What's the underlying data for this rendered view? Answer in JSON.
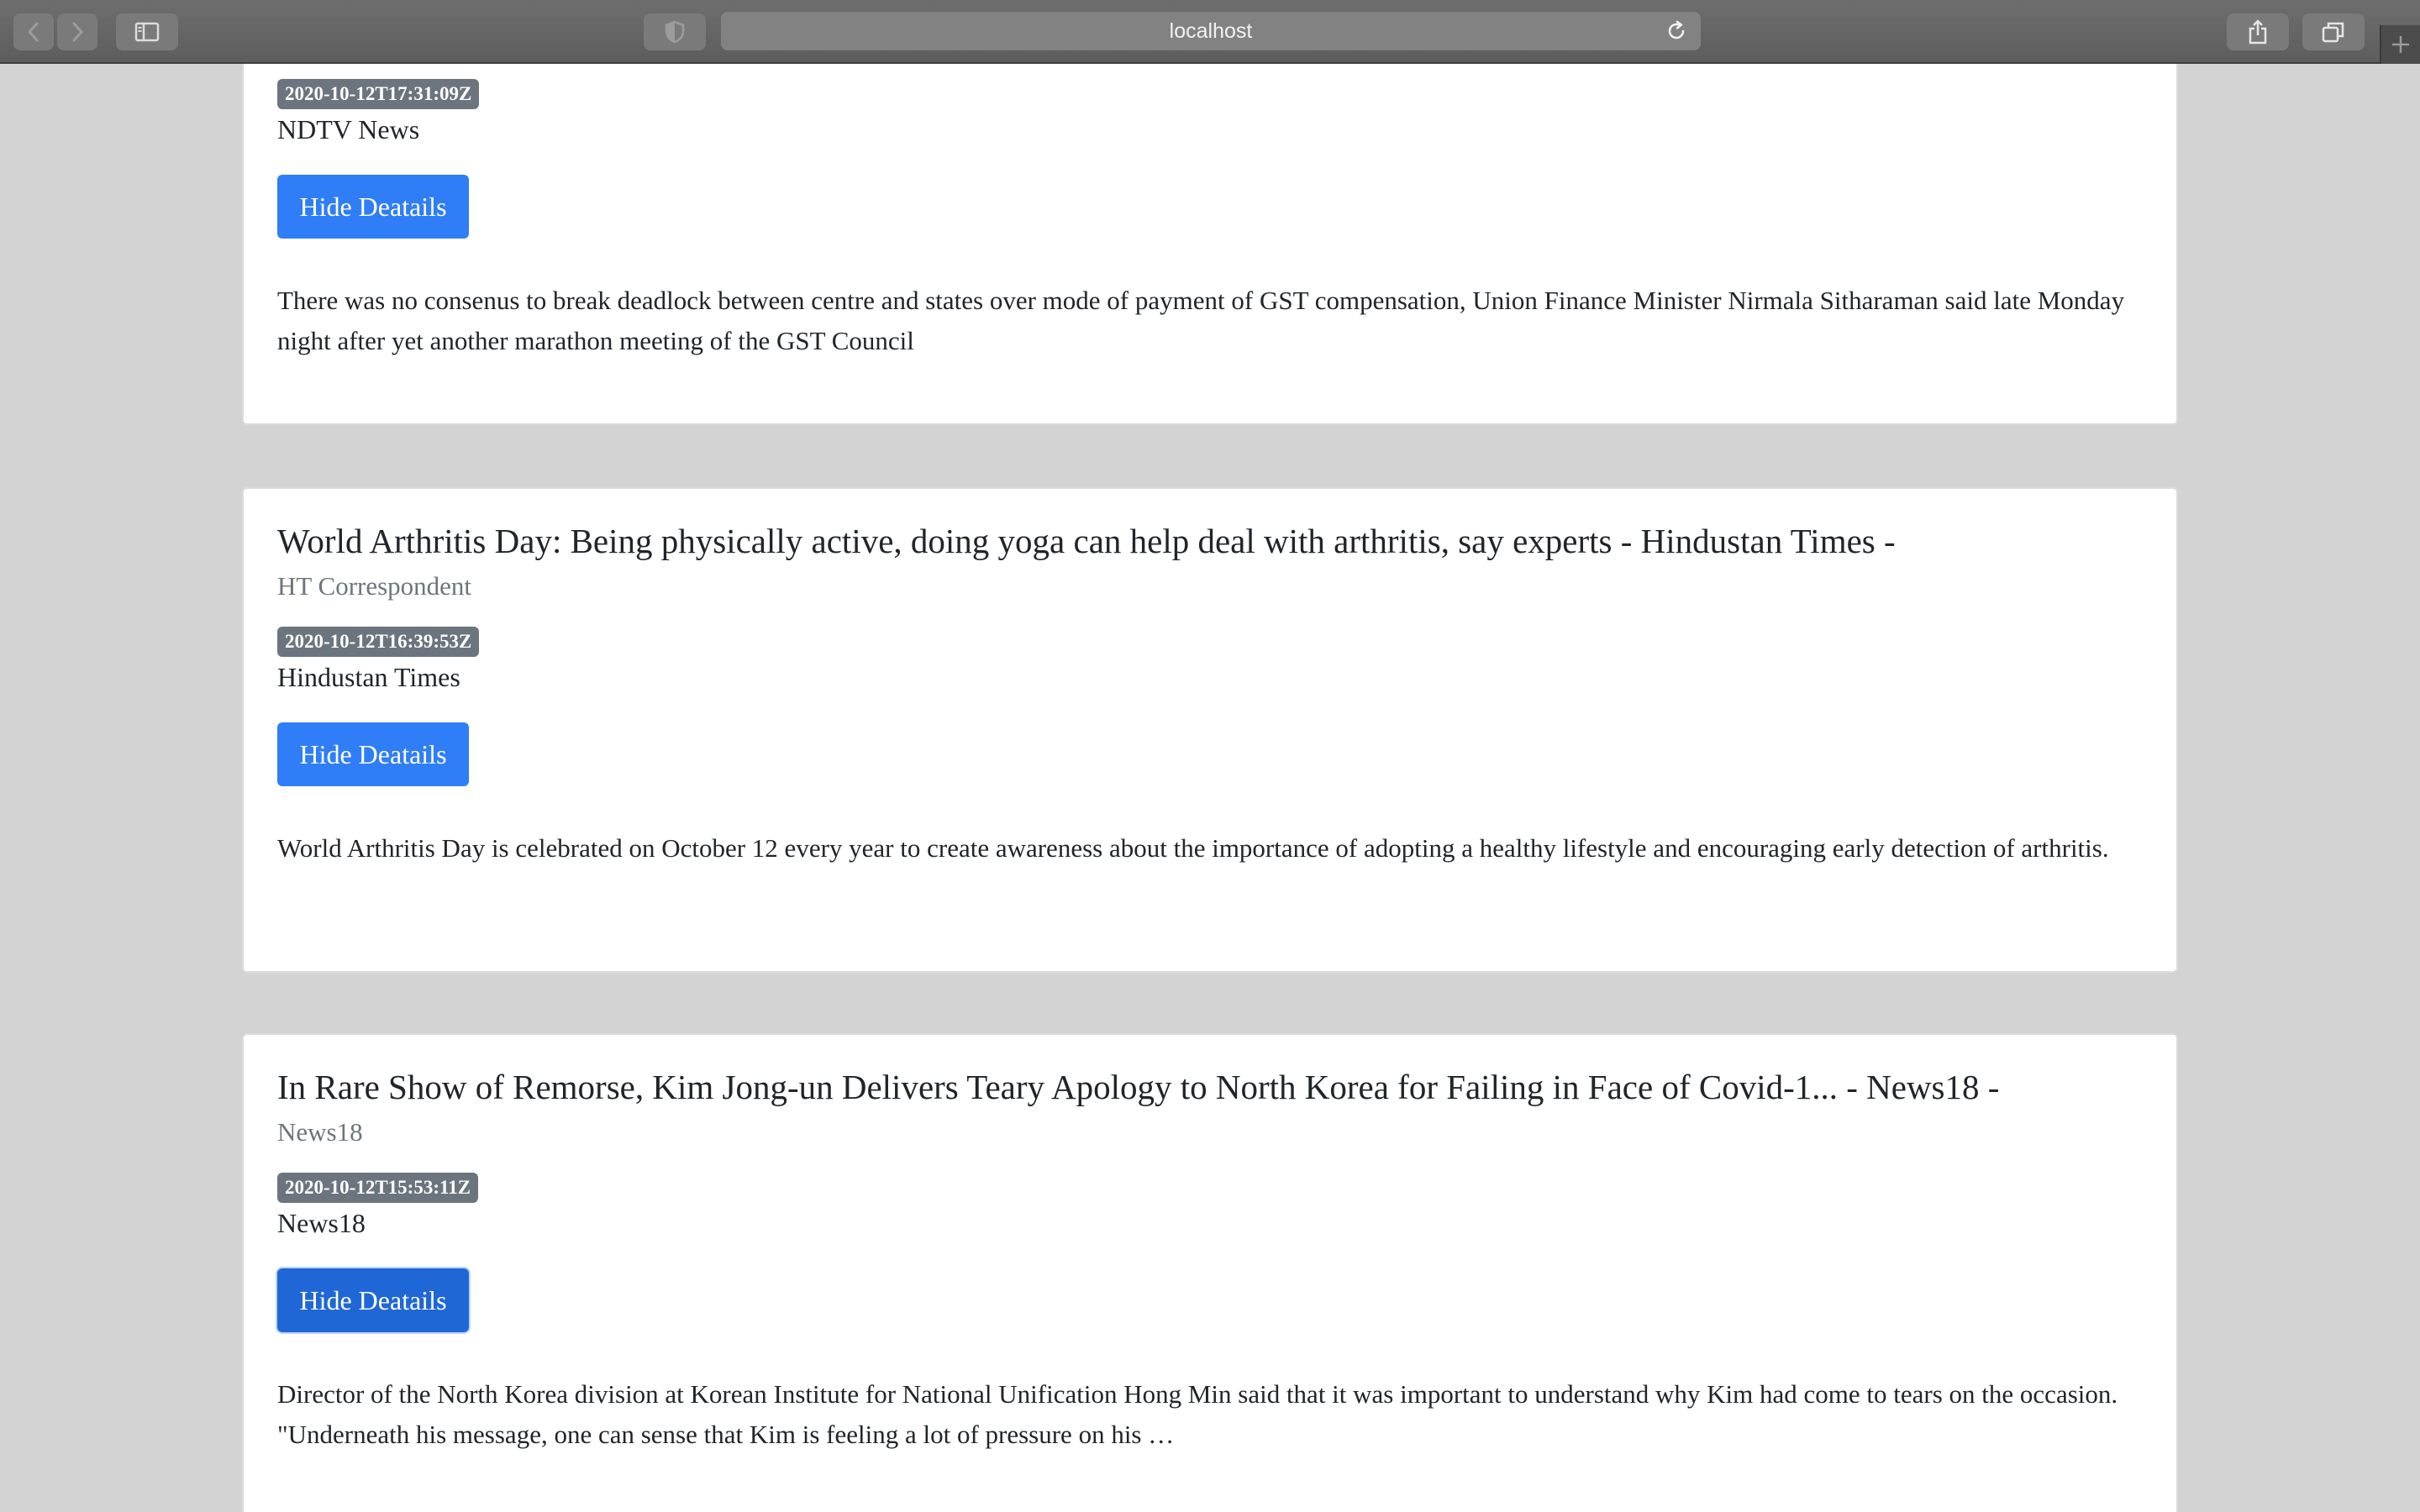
{
  "browser": {
    "url": "localhost",
    "icons": {
      "back": "chevron-left-icon",
      "forward": "chevron-right-icon",
      "sidebar": "sidebar-icon",
      "privacy": "shield-icon",
      "reload": "reload-icon",
      "share": "share-icon",
      "tabs": "tabs-overview-icon",
      "new_tab": "plus-icon"
    }
  },
  "articles": [
    {
      "published_at": "2020-10-12T17:31:09Z",
      "source": "NDTV News",
      "button_label": "Hide Deatails",
      "description": "There was no consenus to break deadlock between centre and states over mode of payment of GST compensation, Union Finance Minister Nirmala Sitharaman said late Monday night after yet another marathon meeting of the GST Council"
    },
    {
      "title": "World Arthritis Day: Being physically active, doing yoga can help deal with arthritis, say experts - Hindustan Times -",
      "author": "HT Correspondent",
      "published_at": "2020-10-12T16:39:53Z",
      "source": "Hindustan Times",
      "button_label": "Hide Deatails",
      "description": "World Arthritis Day is celebrated on October 12 every year to create awareness about the importance of adopting a healthy lifestyle and encouraging early detection of arthritis."
    },
    {
      "title": "In Rare Show of Remorse, Kim Jong-un Delivers Teary Apology to North Korea for Failing in Face of Covid-1... - News18 -",
      "author": "News18",
      "published_at": "2020-10-12T15:53:11Z",
      "source": "News18",
      "button_label": "Hide Deatails",
      "description": "Director of the North Korea division at Korean Institute for National Unification Hong Min said that it was important to understand why Kim had come to tears on the occasion. \"Underneath his message, one can sense that Kim is feeling a lot of pressure on his …"
    }
  ],
  "colors": {
    "page_background": "#d3d3d3",
    "button": "#2f7ef7",
    "badge": "#6c757d",
    "author": "#6c757d"
  }
}
